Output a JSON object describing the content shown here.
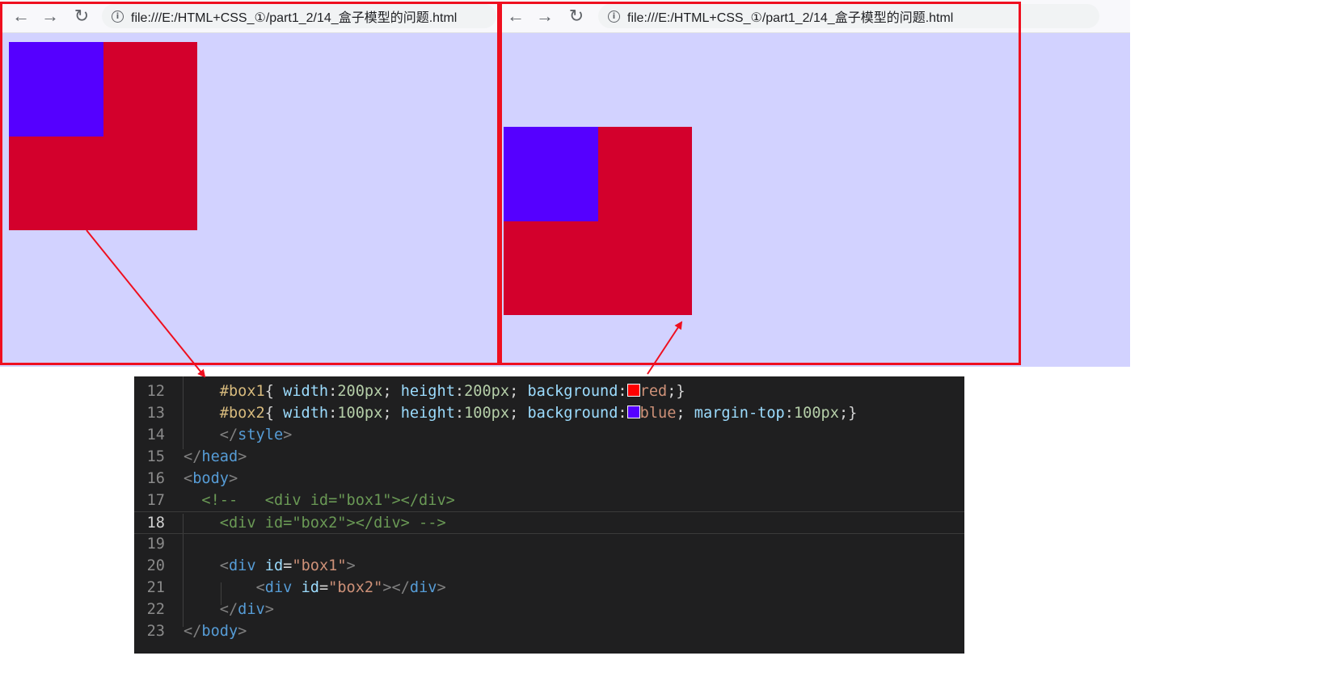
{
  "browsers": [
    {
      "id": "left",
      "url": "file:///E:/HTML+CSS_①/part1_2/14_盒子模型的问题.html",
      "icons": {
        "back": "back-arrow-icon",
        "forward": "forward-arrow-icon",
        "reload": "reload-icon",
        "info": "info-icon"
      }
    },
    {
      "id": "right",
      "url": "file:///E:/HTML+CSS_①/part1_2/14_盒子模型的问题.html",
      "icons": {
        "back": "back-arrow-icon",
        "forward": "forward-arrow-icon",
        "reload": "reload-icon",
        "info": "info-icon"
      }
    }
  ],
  "colors": {
    "viewport_bg": "#d2d2ff",
    "box1": "#d3002c",
    "box2": "#5500ff",
    "frame": "#ef0f1f",
    "editor_bg": "#1f1f20"
  },
  "editor": {
    "active_line": "18",
    "lines": [
      {
        "num": "12",
        "parts": [
          {
            "t": "    "
          },
          {
            "t": "#box1",
            "c": "#d7ba7d"
          },
          {
            "t": "{ ",
            "c": "#d4d4d4"
          },
          {
            "t": "width",
            "c": "#9cdcfe"
          },
          {
            "t": ":",
            "c": "#d4d4d4"
          },
          {
            "t": "200px",
            "c": "#b5cea8"
          },
          {
            "t": "; ",
            "c": "#d4d4d4"
          },
          {
            "t": "height",
            "c": "#9cdcfe"
          },
          {
            "t": ":",
            "c": "#d4d4d4"
          },
          {
            "t": "200px",
            "c": "#b5cea8"
          },
          {
            "t": "; ",
            "c": "#d4d4d4"
          },
          {
            "t": "background",
            "c": "#9cdcfe"
          },
          {
            "t": ":",
            "c": "#d4d4d4"
          },
          {
            "swatch": "#ff0000"
          },
          {
            "t": "red",
            "c": "#ce9178"
          },
          {
            "t": ";}",
            "c": "#d4d4d4"
          }
        ]
      },
      {
        "num": "13",
        "parts": [
          {
            "t": "    "
          },
          {
            "t": "#box2",
            "c": "#d7ba7d"
          },
          {
            "t": "{ ",
            "c": "#d4d4d4"
          },
          {
            "t": "width",
            "c": "#9cdcfe"
          },
          {
            "t": ":",
            "c": "#d4d4d4"
          },
          {
            "t": "100px",
            "c": "#b5cea8"
          },
          {
            "t": "; ",
            "c": "#d4d4d4"
          },
          {
            "t": "height",
            "c": "#9cdcfe"
          },
          {
            "t": ":",
            "c": "#d4d4d4"
          },
          {
            "t": "100px",
            "c": "#b5cea8"
          },
          {
            "t": "; ",
            "c": "#d4d4d4"
          },
          {
            "t": "background",
            "c": "#9cdcfe"
          },
          {
            "t": ":",
            "c": "#d4d4d4"
          },
          {
            "swatch": "#5500ff"
          },
          {
            "t": "blue",
            "c": "#ce9178"
          },
          {
            "t": "; ",
            "c": "#d4d4d4"
          },
          {
            "t": "margin-top",
            "c": "#9cdcfe"
          },
          {
            "t": ":",
            "c": "#d4d4d4"
          },
          {
            "t": "100px",
            "c": "#b5cea8"
          },
          {
            "t": ";}",
            "c": "#d4d4d4"
          }
        ]
      },
      {
        "num": "14",
        "parts": [
          {
            "t": "    "
          },
          {
            "t": "</",
            "c": "#808080"
          },
          {
            "t": "style",
            "c": "#569cd6"
          },
          {
            "t": ">",
            "c": "#808080"
          }
        ]
      },
      {
        "num": "15",
        "parts": [
          {
            "t": "</",
            "c": "#808080"
          },
          {
            "t": "head",
            "c": "#569cd6"
          },
          {
            "t": ">",
            "c": "#808080"
          }
        ]
      },
      {
        "num": "16",
        "parts": [
          {
            "t": "<",
            "c": "#808080"
          },
          {
            "t": "body",
            "c": "#569cd6"
          },
          {
            "t": ">",
            "c": "#808080"
          }
        ]
      },
      {
        "num": "17",
        "parts": [
          {
            "t": "  <!--   <div id=\"box1\"></div>",
            "c": "#6a9955"
          }
        ]
      },
      {
        "num": "18",
        "parts": [
          {
            "t": "    <div id=\"box2\"></div> -->",
            "c": "#6a9955"
          }
        ]
      },
      {
        "num": "19",
        "parts": []
      },
      {
        "num": "20",
        "parts": [
          {
            "t": "    "
          },
          {
            "t": "<",
            "c": "#808080"
          },
          {
            "t": "div",
            "c": "#569cd6"
          },
          {
            "t": " "
          },
          {
            "t": "id",
            "c": "#9cdcfe"
          },
          {
            "t": "=",
            "c": "#d4d4d4"
          },
          {
            "t": "\"box1\"",
            "c": "#ce9178"
          },
          {
            "t": ">",
            "c": "#808080"
          }
        ]
      },
      {
        "num": "21",
        "parts": [
          {
            "t": "        "
          },
          {
            "t": "<",
            "c": "#808080"
          },
          {
            "t": "div",
            "c": "#569cd6"
          },
          {
            "t": " "
          },
          {
            "t": "id",
            "c": "#9cdcfe"
          },
          {
            "t": "=",
            "c": "#d4d4d4"
          },
          {
            "t": "\"box2\"",
            "c": "#ce9178"
          },
          {
            "t": "></",
            "c": "#808080"
          },
          {
            "t": "div",
            "c": "#569cd6"
          },
          {
            "t": ">",
            "c": "#808080"
          }
        ]
      },
      {
        "num": "22",
        "parts": [
          {
            "t": "    "
          },
          {
            "t": "</",
            "c": "#808080"
          },
          {
            "t": "div",
            "c": "#569cd6"
          },
          {
            "t": ">",
            "c": "#808080"
          }
        ]
      },
      {
        "num": "23",
        "parts": [
          {
            "t": "</",
            "c": "#808080"
          },
          {
            "t": "body",
            "c": "#569cd6"
          },
          {
            "t": ">",
            "c": "#808080"
          }
        ]
      }
    ]
  }
}
